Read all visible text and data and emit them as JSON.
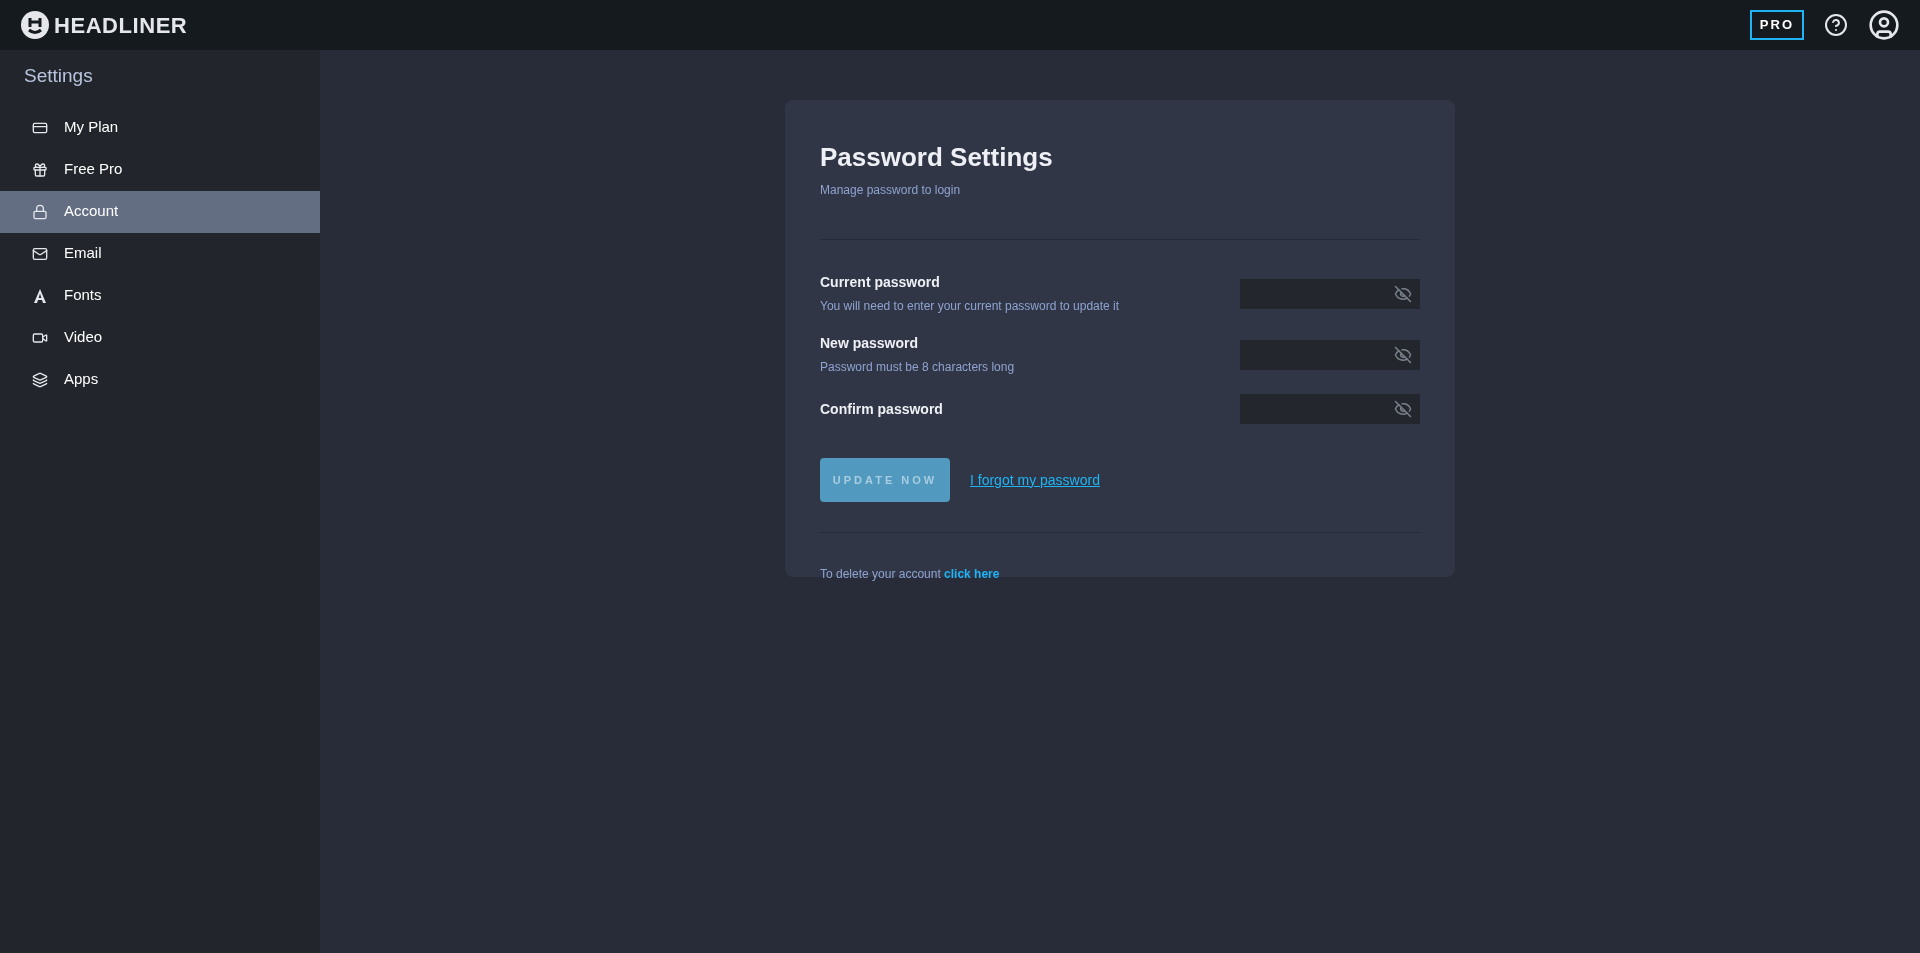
{
  "topbar": {
    "logo": "HEADLINER",
    "pro_badge": "PRO"
  },
  "sidebar": {
    "title": "Settings",
    "items": [
      {
        "label": "My Plan",
        "kind": "card",
        "selected": false
      },
      {
        "label": "Free Pro",
        "kind": "gift",
        "selected": false
      },
      {
        "label": "Account",
        "kind": "lock",
        "selected": true
      },
      {
        "label": "Email",
        "kind": "mail",
        "selected": false
      },
      {
        "label": "Fonts",
        "kind": "font",
        "selected": false
      },
      {
        "label": "Video",
        "kind": "video",
        "selected": false
      },
      {
        "label": "Apps",
        "kind": "layers",
        "selected": false
      }
    ]
  },
  "card": {
    "title": "Password Settings",
    "subtitle": "Manage password to login",
    "fields": [
      {
        "label": "Current password",
        "hint": "You will need to enter your current password to update it"
      },
      {
        "label": "New password",
        "hint": "Password must be 8 characters long"
      },
      {
        "label": "Confirm password"
      }
    ],
    "update_button": {
      "label": "UPDATE NOW",
      "disabled": true
    },
    "forgot_link": "I forgot my password",
    "delete_text": "To delete your account",
    "delete_link": "click here"
  }
}
